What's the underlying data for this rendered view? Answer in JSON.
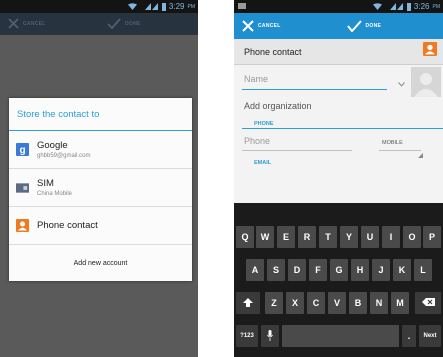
{
  "left_screen": {
    "status_time": "3:29",
    "status_ampm": "PM",
    "actionbar": {
      "cancel_label": "CANCEL",
      "done_label": "DONE"
    },
    "dialog": {
      "title": "Store the contact to",
      "accounts": [
        {
          "name": "Google",
          "sub": "ghbb59@gmail.com",
          "icon": "google-icon"
        },
        {
          "name": "SIM",
          "sub": "China Mobile",
          "icon": "sim-card-icon"
        },
        {
          "name": "Phone contact",
          "sub": "",
          "icon": "phone-contact-icon"
        }
      ],
      "add_account_label": "Add new account"
    }
  },
  "right_screen": {
    "status_time": "3:26",
    "status_ampm": "PM",
    "actionbar": {
      "cancel_label": "CANCEL",
      "done_label": "DONE"
    },
    "account_header": "Phone contact",
    "form": {
      "name_placeholder": "Name",
      "organization_label": "Add organization",
      "phone_section": "PHONE",
      "phone_placeholder": "Phone",
      "phone_type": "MOBILE",
      "email_section": "EMAIL"
    },
    "keyboard": {
      "row1": [
        "Q",
        "W",
        "E",
        "R",
        "T",
        "Y",
        "U",
        "I",
        "O",
        "P"
      ],
      "row2": [
        "A",
        "S",
        "D",
        "F",
        "G",
        "H",
        "J",
        "K",
        "L"
      ],
      "row3": [
        "Z",
        "X",
        "C",
        "V",
        "B",
        "N",
        "M"
      ],
      "symbols_key": "?123",
      "period_key": ".",
      "next_key": "Next"
    }
  },
  "colors": {
    "holo_blue": "#2d9fd6",
    "actionbar_blue": "#1f8fd0",
    "contact_orange": "#f07a20",
    "google_blue": "#3b7bd4"
  }
}
